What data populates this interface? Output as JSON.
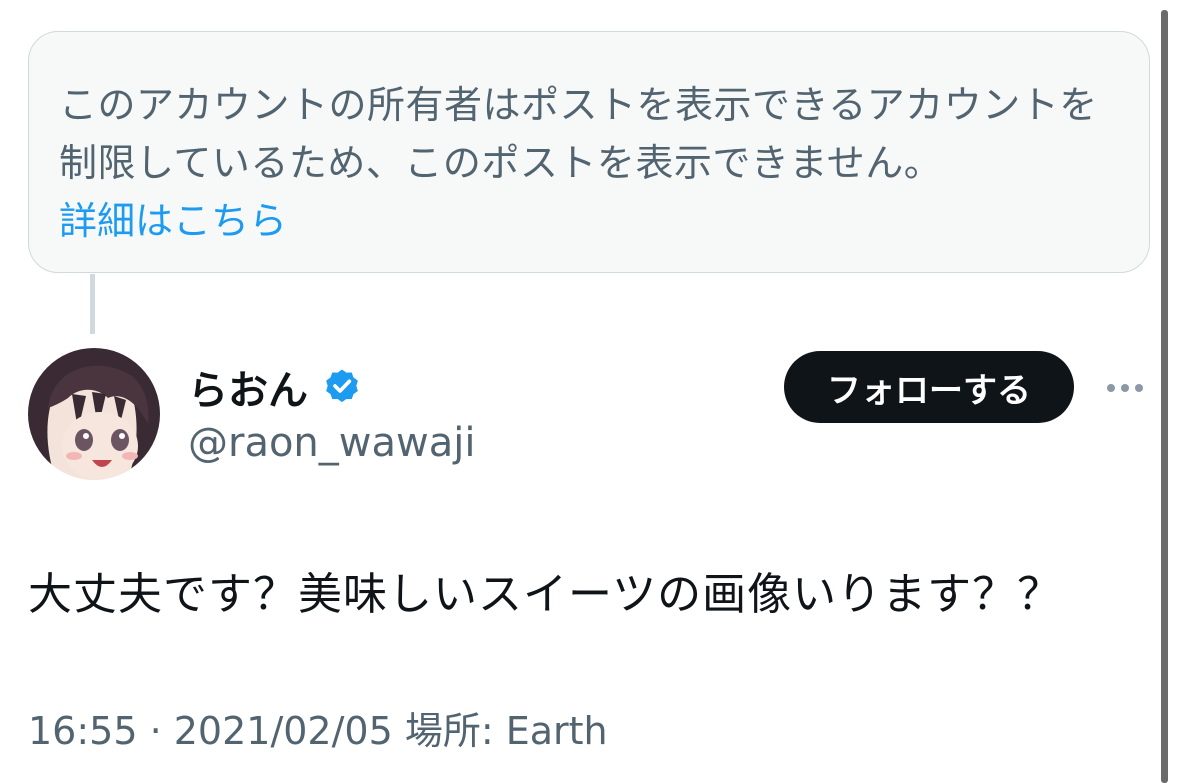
{
  "notice": {
    "text": "このアカウントの所有者はポストを表示できるアカウントを制限しているため、このポストを表示できません。",
    "link": "詳細はこちら"
  },
  "author": {
    "display_name": "らおん",
    "handle": "@raon_wawaji",
    "verified": true,
    "verified_color": "#1d9bf0"
  },
  "actions": {
    "follow_label": "フォローする",
    "more_icon": "more-horizontal-icon"
  },
  "tweet": {
    "text": "大丈夫です？美味しいスイーツの画像いります？？"
  },
  "meta": {
    "text": "16:55 · 2021/02/05 場所: Earth"
  },
  "colors": {
    "link": "#1d9bf0",
    "secondary_text": "#536471",
    "button_bg": "#0f1419"
  }
}
